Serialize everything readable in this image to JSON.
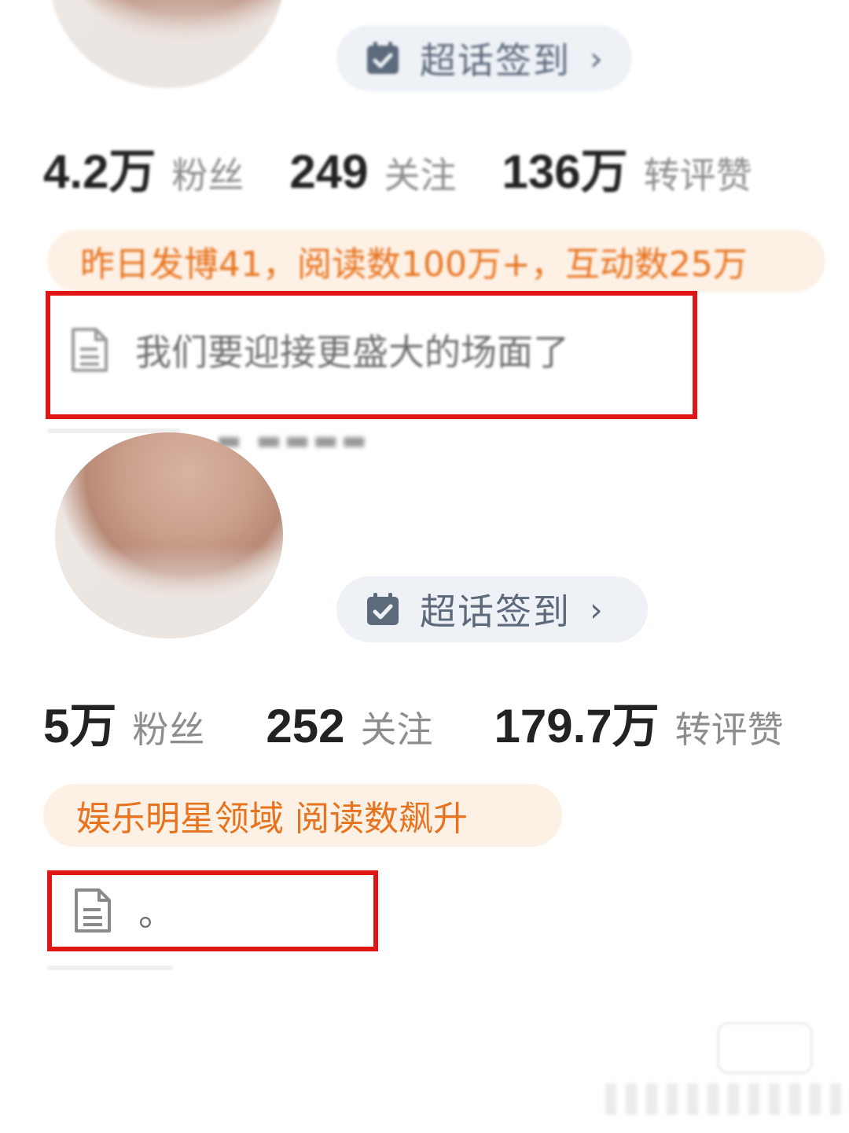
{
  "profiles": [
    {
      "checkin_label": "超话签到",
      "checkin_chevron": "›",
      "stats": [
        {
          "value": "4.2万",
          "label": "粉丝"
        },
        {
          "value": "249",
          "label": "关注"
        },
        {
          "value": "136万",
          "label": "转评赞"
        }
      ],
      "highlight": "昨日发博41，阅读数100万+，互动数25万",
      "intro": "我们要迎接更盛大的场面了"
    },
    {
      "checkin_label": "超话签到",
      "checkin_chevron": "›",
      "stats": [
        {
          "value": "5万",
          "label": "粉丝"
        },
        {
          "value": "252",
          "label": "关注"
        },
        {
          "value": "179.7万",
          "label": "转评赞"
        }
      ],
      "highlight": "娱乐明星领域 阅读数飙升",
      "intro": "。"
    }
  ],
  "colors": {
    "annotation_red": "#e01515",
    "highlight_orange": "#e7731e",
    "highlight_bg": "#fdf1e6",
    "checkin_bg": "#eef2f7"
  },
  "icons": [
    "calendar-check-icon",
    "document-icon",
    "chevron-right-icon"
  ]
}
